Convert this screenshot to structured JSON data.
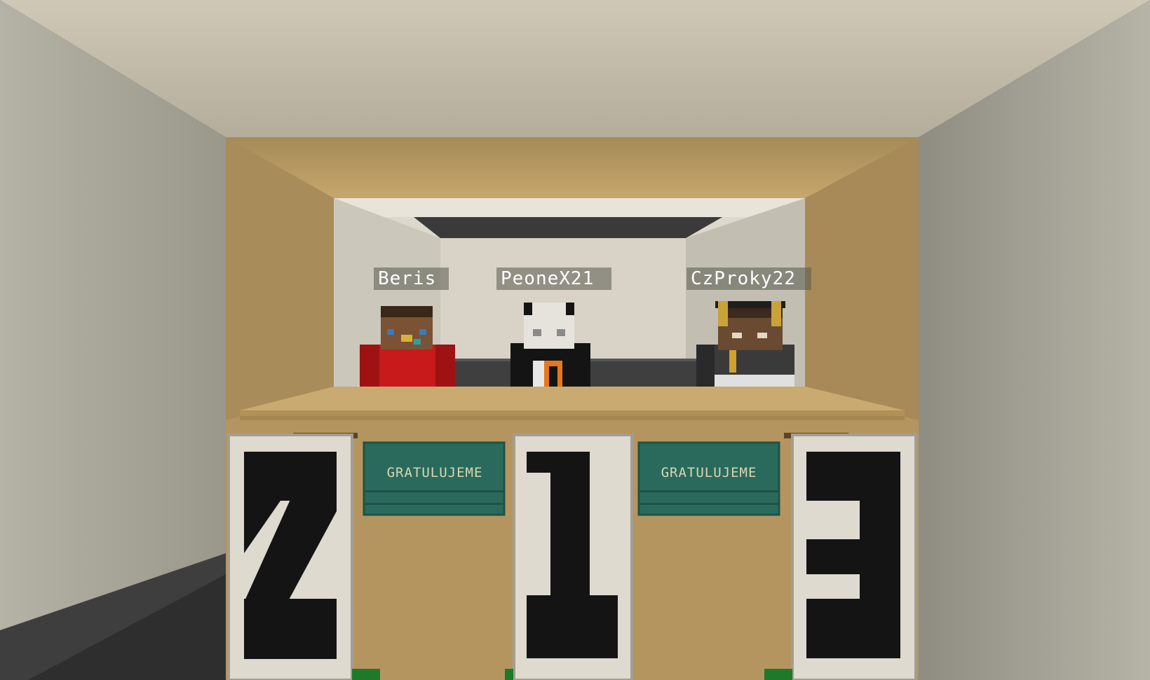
{
  "players": {
    "left": {
      "name": "Beris",
      "place": "2"
    },
    "center": {
      "name": "PeoneX21",
      "place": "1"
    },
    "right": {
      "name": "CzProky22",
      "place": "3"
    }
  },
  "signs": {
    "left": "GRATULUJEME",
    "right": "GRATULUJEME"
  },
  "colors": {
    "wall_light": "#d8d4c8",
    "wall_shadow": "#8e8c80",
    "wood_plank": "#b9975f",
    "dark_stone": "#3c3c3c",
    "sign_green": "#2a6a5c",
    "banner_white": "#dedad0",
    "banner_black": "#141414"
  }
}
